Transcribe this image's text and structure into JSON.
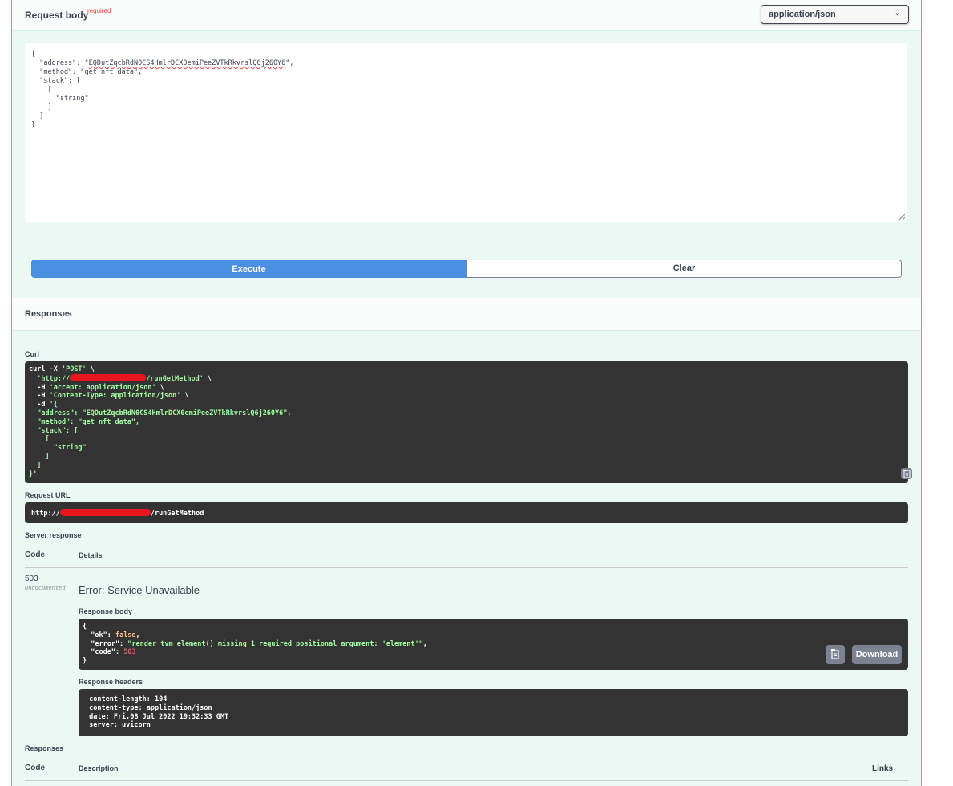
{
  "request_body": {
    "title": "Request body",
    "required_label": "required",
    "content_type": "application/json",
    "editor_lines": [
      "{",
      "  \"address\": \"EQDutZqcbRdN0CS4HmlrDCX0emiPeeZVTkRkvrslQ6j260Y6\",",
      "  \"method\": \"get_nft_data\",",
      "  \"stack\": [",
      "    [",
      "      \"string\"",
      "    ]",
      "  ]",
      "}"
    ]
  },
  "buttons": {
    "execute": "Execute",
    "clear": "Clear",
    "download": "Download"
  },
  "responses_header": "Responses",
  "curl": {
    "label": "Curl",
    "line1_prefix": "curl -X ",
    "line1_method": "'POST'",
    "line1_suffix": " \\",
    "line2_url_start": "  'http://",
    "line2_url_end": "/runGetMethod'",
    "line2_suffix": " \\",
    "line3_flag": "  -H ",
    "line3_value": "'accept: application/json'",
    "line3_suffix": " \\",
    "line4_flag": "  -H ",
    "line4_value": "'Content-Type: application/json'",
    "line4_suffix": " \\",
    "line5_flag": "  -d ",
    "line5_value": "'{",
    "body_lines": [
      "  \"address\": \"EQDutZqcbRdN0CS4HmlrDCX0emiPeeZVTkRkvrslQ6j260Y6\",",
      "  \"method\": \"get_nft_data\",",
      "  \"stack\": [",
      "    [",
      "      \"string\"",
      "    ]",
      "  ]",
      "}'"
    ]
  },
  "request_url": {
    "label": "Request URL",
    "start": "http://",
    "end": "/runGetMethod"
  },
  "server_response": {
    "label": "Server response",
    "col_code": "Code",
    "col_details": "Details",
    "code": "503",
    "undocumented": "Undocumented",
    "error_title": "Error: Service Unavailable",
    "response_body_label": "Response body",
    "body": {
      "open": "{",
      "ok_key": "  \"ok\": ",
      "ok_val": "false",
      "error_key": "  \"error\": ",
      "error_val": "\"render_tvm_element() missing 1 required positional argument: 'element'\"",
      "code_key": "  \"code\": ",
      "code_val": "503",
      "close": "}"
    },
    "response_headers_label": "Response headers",
    "headers": [
      " content-length: 104 ",
      " content-type: application/json ",
      " date: Fri,08 Jul 2022 19:32:33 GMT ",
      " server: uvicorn "
    ]
  },
  "responses_section": {
    "label": "Responses",
    "col_code": "Code",
    "col_description": "Description",
    "col_links": "Links"
  },
  "colors": {
    "frame_bg": "#ecf8f3",
    "frame_border": "#49cc90",
    "execute": "#4990e2",
    "code_bg": "#333333",
    "string_green": "#a2fca2",
    "number_red": "#d36363",
    "redaction": "#e8141e"
  }
}
